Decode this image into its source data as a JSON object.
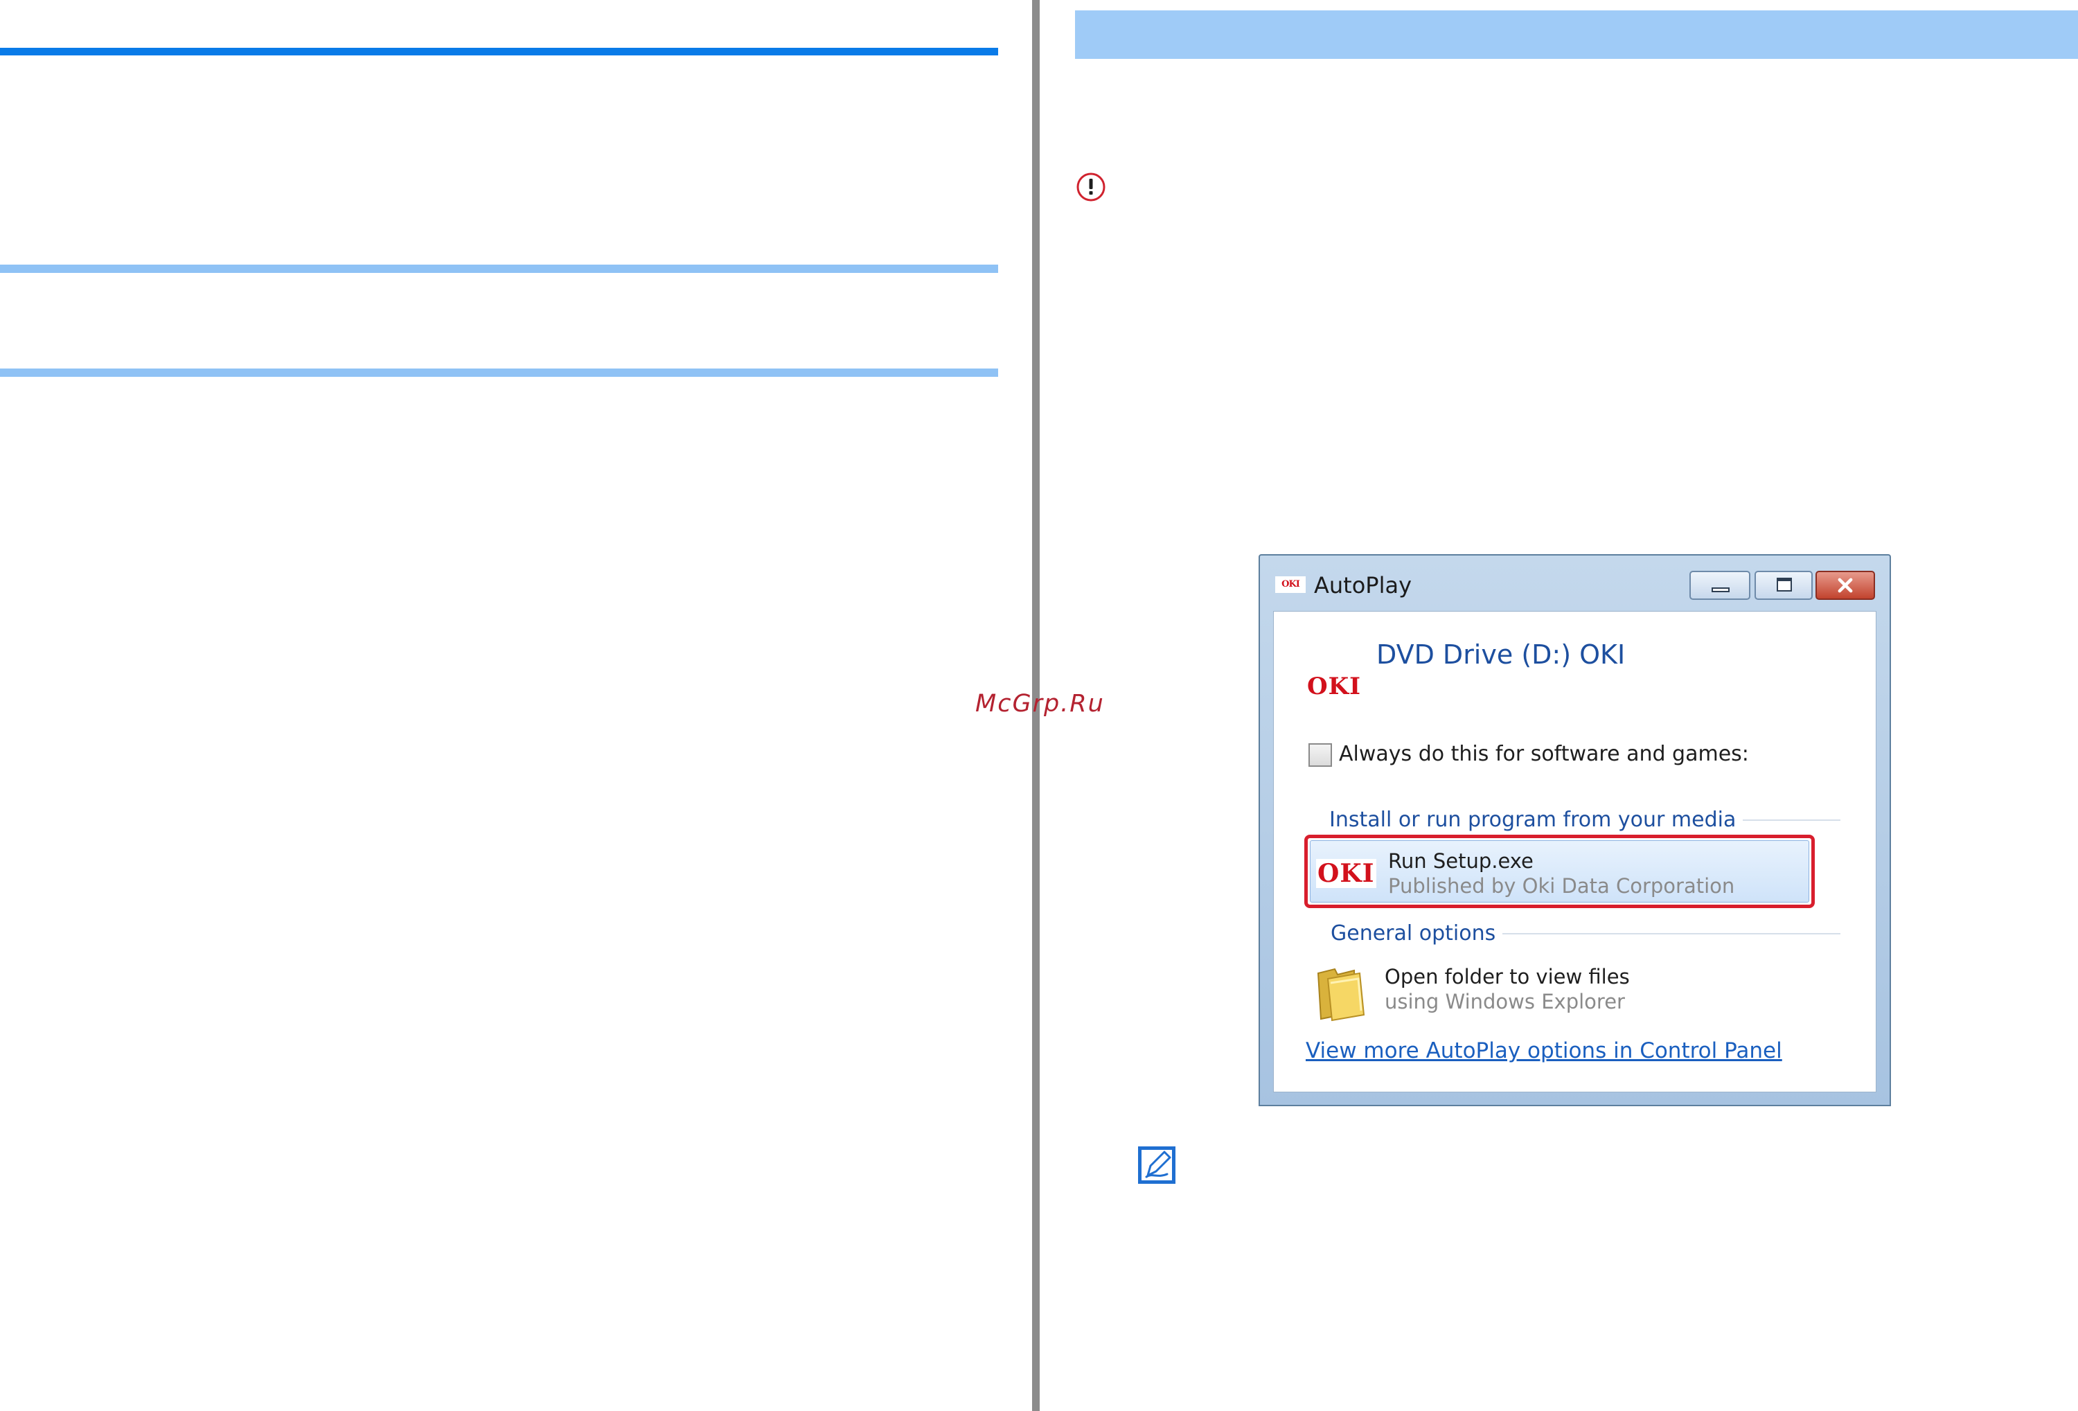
{
  "watermark": "McGrp.Ru",
  "autoplay": {
    "title": "AutoPlay",
    "title_logo": "OKI",
    "drive_logo": "OKI",
    "drive_title": "DVD Drive (D:) OKI",
    "always_label": "Always do this for software and games:",
    "always_checked": false,
    "install_heading": "Install or run program from your media",
    "run_logo": "OKI",
    "run_title": "Run Setup.exe",
    "run_subtitle": "Published by Oki Data Corporation",
    "general_heading": "General options",
    "folder_title": "Open folder to view files",
    "folder_subtitle": "using Windows Explorer",
    "control_panel_link": "View more AutoPlay options in Control Panel"
  },
  "icons": {
    "caution": "caution-icon",
    "note": "note-pencil-icon",
    "folder": "folder-icon",
    "minimize": "minimize-icon",
    "maximize": "maximize-icon",
    "close": "close-icon"
  },
  "colors": {
    "accent_dark": "#0a7be8",
    "accent_light": "#8fc2f5",
    "header_band": "#9fcbf7",
    "highlight": "#d81e2d",
    "brand": "#d2111c",
    "link": "#1a5fbf"
  }
}
